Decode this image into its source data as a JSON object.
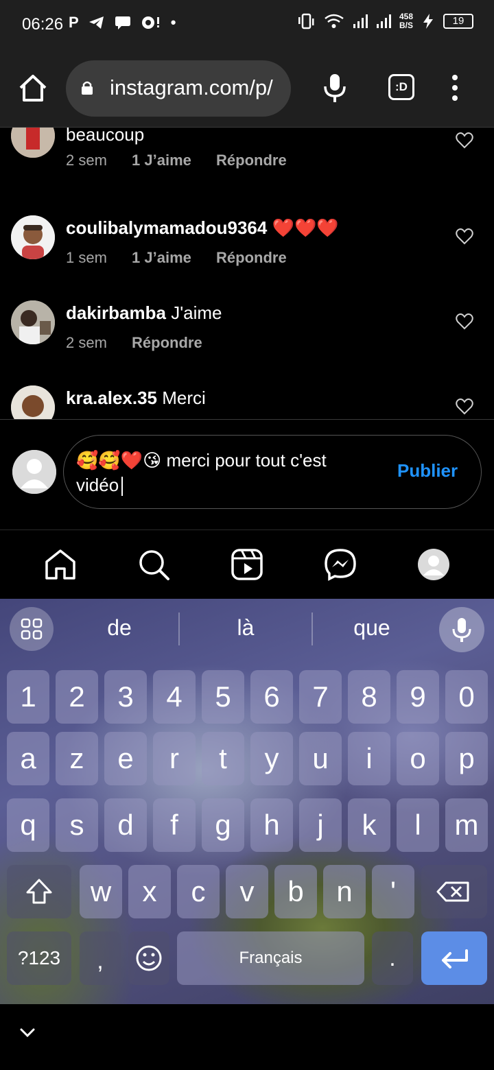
{
  "status": {
    "time": "06:26",
    "left_icons": [
      "P",
      "telegram-icon",
      "chat-icon",
      "assistant-icon",
      "•"
    ],
    "net_speed_value": "458",
    "net_speed_unit": "B/S",
    "battery": "19"
  },
  "browser": {
    "url": "instagram.com/p/",
    "tab_label": ":D"
  },
  "comments": [
    {
      "username": "",
      "text": "beaucoup",
      "time": "2 sem",
      "likes": "1 J’aime",
      "reply": "Répondre"
    },
    {
      "username": "coulibalymamadou9364",
      "text": "❤️❤️❤️",
      "time": "1 sem",
      "likes": "1 J’aime",
      "reply": "Répondre"
    },
    {
      "username": "dakirbamba",
      "text": "J'aime",
      "time": "2 sem",
      "likes": "",
      "reply": "Répondre"
    },
    {
      "username": "kra.alex.35",
      "text": "Merci",
      "time": "",
      "likes": "",
      "reply": ""
    }
  ],
  "compose": {
    "value": "🥰🥰❤️😘 merci pour tout c'est vidéo",
    "publish_label": "Publier"
  },
  "keyboard": {
    "suggestions": [
      "de",
      "là",
      "que"
    ],
    "row_numbers": [
      "1",
      "2",
      "3",
      "4",
      "5",
      "6",
      "7",
      "8",
      "9",
      "0"
    ],
    "row1": [
      "a",
      "z",
      "e",
      "r",
      "t",
      "y",
      "u",
      "i",
      "o",
      "p"
    ],
    "row2": [
      "q",
      "s",
      "d",
      "f",
      "g",
      "h",
      "j",
      "k",
      "l",
      "m"
    ],
    "row3": [
      "w",
      "x",
      "c",
      "v",
      "b",
      "n",
      "'"
    ],
    "symbols_label": "?123",
    "comma": ",",
    "space_label": "Français",
    "period": "."
  },
  "colors": {
    "accent": "#1f93ff",
    "enter_key": "#5c8de6"
  }
}
